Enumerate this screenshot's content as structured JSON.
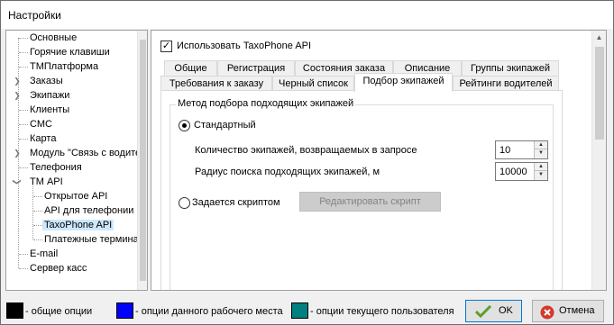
{
  "window": {
    "title": "Настройки"
  },
  "sidebar": {
    "items": [
      {
        "label": "Основные"
      },
      {
        "label": "Горячие клавиши"
      },
      {
        "label": "ТМПлатформа"
      },
      {
        "label": "Заказы",
        "expandable": true
      },
      {
        "label": "Экипажи",
        "expandable": true
      },
      {
        "label": "Клиенты"
      },
      {
        "label": "СМС"
      },
      {
        "label": "Карта"
      },
      {
        "label": "Модуль \"Связь с водителя",
        "expandable": true
      },
      {
        "label": "Телефония"
      },
      {
        "label": "ТМ API",
        "expanded": true
      },
      {
        "label": "Открытое API"
      },
      {
        "label": "API для телефонии"
      },
      {
        "label": "TaxoPhone API",
        "selected": true
      },
      {
        "label": "Платежные терминалы"
      },
      {
        "label": "E-mail"
      },
      {
        "label": "Сервер касс"
      }
    ]
  },
  "panel": {
    "use_checkbox_label": "Использовать TaxoPhone API",
    "use_checkbox_checked": true,
    "tabs_row1": [
      "Общие",
      "Регистрация",
      "Состояния заказа",
      "Описание",
      "Группы экипажей"
    ],
    "tabs_row2": [
      "Требования к заказу",
      "Черный список",
      "Подбор экипажей",
      "Рейтинги водителей"
    ],
    "active_tab": "Подбор экипажей",
    "group_title": "Метод подбора подходящих экипажей",
    "radio_standard_label": "Стандартный",
    "radio_standard_selected": true,
    "count_label": "Количество экипажей, возвращаемых в запросе",
    "count_value": "10",
    "radius_label": "Радиус поиска подходящих экипажей, м",
    "radius_value": "10000",
    "radio_script_label": "Задается скриптом",
    "radio_script_selected": false,
    "edit_script_button": "Редактировать скрипт"
  },
  "legend": [
    {
      "color": "#000000",
      "label": "- общие опции"
    },
    {
      "color": "#0000ff",
      "label": "- опции данного рабочего места"
    },
    {
      "color": "#008080",
      "label": "- опции текущего пользователя"
    }
  ],
  "buttons": {
    "ok": "OK",
    "cancel": "Отмена"
  },
  "icons": {
    "ok": "check-icon",
    "cancel": "cancel-icon",
    "expander": "chevron-right-icon"
  }
}
